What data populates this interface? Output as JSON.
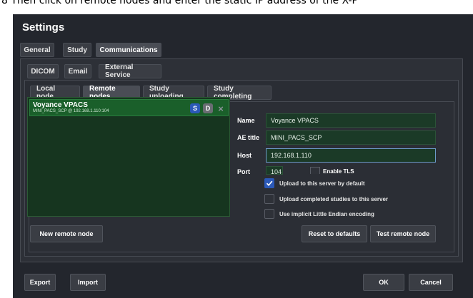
{
  "caption": "8 Then click on remote nodes and enter the static IP address of the X-P",
  "window": {
    "title": "Settings"
  },
  "tabs_level1": [
    "General",
    "Study",
    "Communications"
  ],
  "tabs_level2": [
    "DICOM",
    "Email",
    "External Service"
  ],
  "tabs_level3": [
    "Local node",
    "Remote nodes",
    "Study uploading",
    "Study completing"
  ],
  "list": {
    "item_name": "Voyance VPACS",
    "item_sub": "MINI_PACS_SCP @ 192.168.1.110:104",
    "btn_s": "S",
    "btn_d": "D",
    "btn_x": "×"
  },
  "form": {
    "name_label": "Name",
    "name_value": "Voyance VPACS",
    "ae_label": "AE title",
    "ae_value": "MINI_PACS_SCP",
    "host_label": "Host",
    "host_value": "192.168.1.110",
    "port_label": "Port",
    "port_value": "104",
    "tls_label": "Enable TLS"
  },
  "checks": {
    "upload_default": "Upload to this server by default",
    "upload_completed": "Upload completed studies to this server",
    "implicit_le": "Use implicit Little Endian encoding"
  },
  "buttons": {
    "new_remote": "New remote node",
    "reset": "Reset to defaults",
    "test_remote": "Test remote node",
    "export": "Export",
    "import": "Import",
    "ok": "OK",
    "cancel": "Cancel"
  },
  "colors": {
    "window_bg": "#23262d",
    "list_bg": "#16351f",
    "selected_bg": "#1a5f2a",
    "accent": "#2b59b8"
  }
}
